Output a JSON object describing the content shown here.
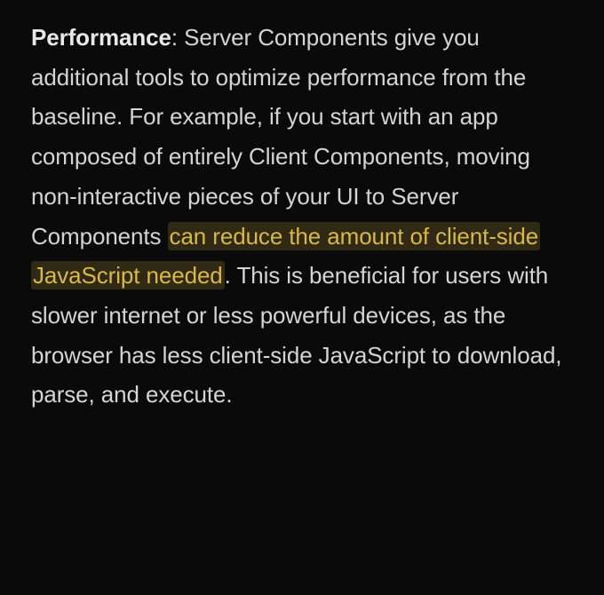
{
  "paragraph": {
    "label": "Performance",
    "before_highlight": ": Server Components give you additional tools to optimize performance from the baseline. For example, if you start with an app composed of entirely Client Components, moving non-interactive pieces of your UI to Server Components ",
    "highlighted": "can reduce the amount of client-side JavaScript needed",
    "after_highlight": ". This is beneficial for users with slower internet or less powerful devices, as the browser has less client-side JavaScript to download, parse, and execute."
  }
}
